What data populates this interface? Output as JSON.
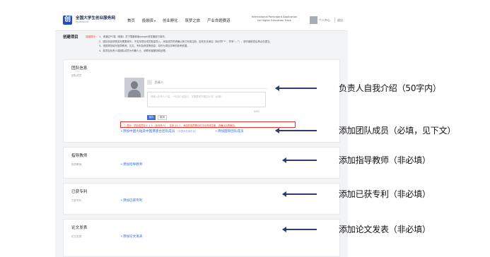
{
  "header": {
    "logo_glyph": "创",
    "site_title": "全国大学生创业服务网",
    "site_subtitle": "cy.ncss.cn",
    "nav": [
      {
        "label": "首页"
      },
      {
        "label": "投融资",
        "caret": "▾"
      },
      {
        "label": "创业孵化"
      },
      {
        "label": "筑梦之旅"
      },
      {
        "label": "产业命题赛道"
      }
    ],
    "intl_line1": "International Participant Application",
    "intl_line2": "for Higher Education Track",
    "user_name": "个人中心",
    "logout": "退出"
  },
  "create": {
    "title": "创建项目",
    "notice_label": "温馨提示：",
    "notes": [
      "1、请通过PC端（电脑）并下载最新版google浏览器进行操作。",
      "2、团队信息请按实际需要填写，不支持项目成员批量导入；添加成员时请确认其已完成注册，否则无法添加（标识符“*”，符号“—”），请仔细核查后再点击提交。",
      "3、请按规范填写指导教师、论文、专利及获奖等信息，将作为项目评审的参考依据。",
      "4、若项目负责人或团队成员为外籍人士，请联系客服协助处理。"
    ]
  },
  "team": {
    "title": "团队信息",
    "sub": "团队成员",
    "member_name": "负责人",
    "intro_placeholder": "请输入负责人介绍，一句话介绍自己，字数要求不超过50字（必填）",
    "counter": "0/50",
    "save_label": "保存",
    "cancel_label": "取消",
    "warning": "ⓘ 提示：项目成员至少 1 人（含负责人），至多 15 人，添加的成员需已在平台完成注册，请确认后再添加。",
    "add_member_label": "+添加中国大陆及中国港澳台团队成员",
    "add_member_note": "（中国大陆身份证）",
    "add_intl_label": "+添加国际团队成员"
  },
  "teacher": {
    "title": "指导教师",
    "sub": "指导教师",
    "add_label": "+添加指导教师"
  },
  "patent": {
    "title": "已获专利",
    "sub": "已获专利",
    "add_label": "+添加已获专利"
  },
  "paper": {
    "title": "论文发表",
    "sub": "论文发表",
    "add_label": "+添加论文发表"
  },
  "annotations": {
    "leader_intro": "负责人自我介绍（50字内）",
    "add_member": "添加团队成员（必填，见下文）",
    "add_teacher": "添加指导教师（非必填）",
    "add_patent": "添加已获专利（非必填）",
    "add_paper": "添加论文发表（非必填）"
  },
  "colors": {
    "brand": "#1f4fbf",
    "link": "#2d6de0",
    "warning": "#e2322a",
    "arrow": "#2b3e6f"
  }
}
